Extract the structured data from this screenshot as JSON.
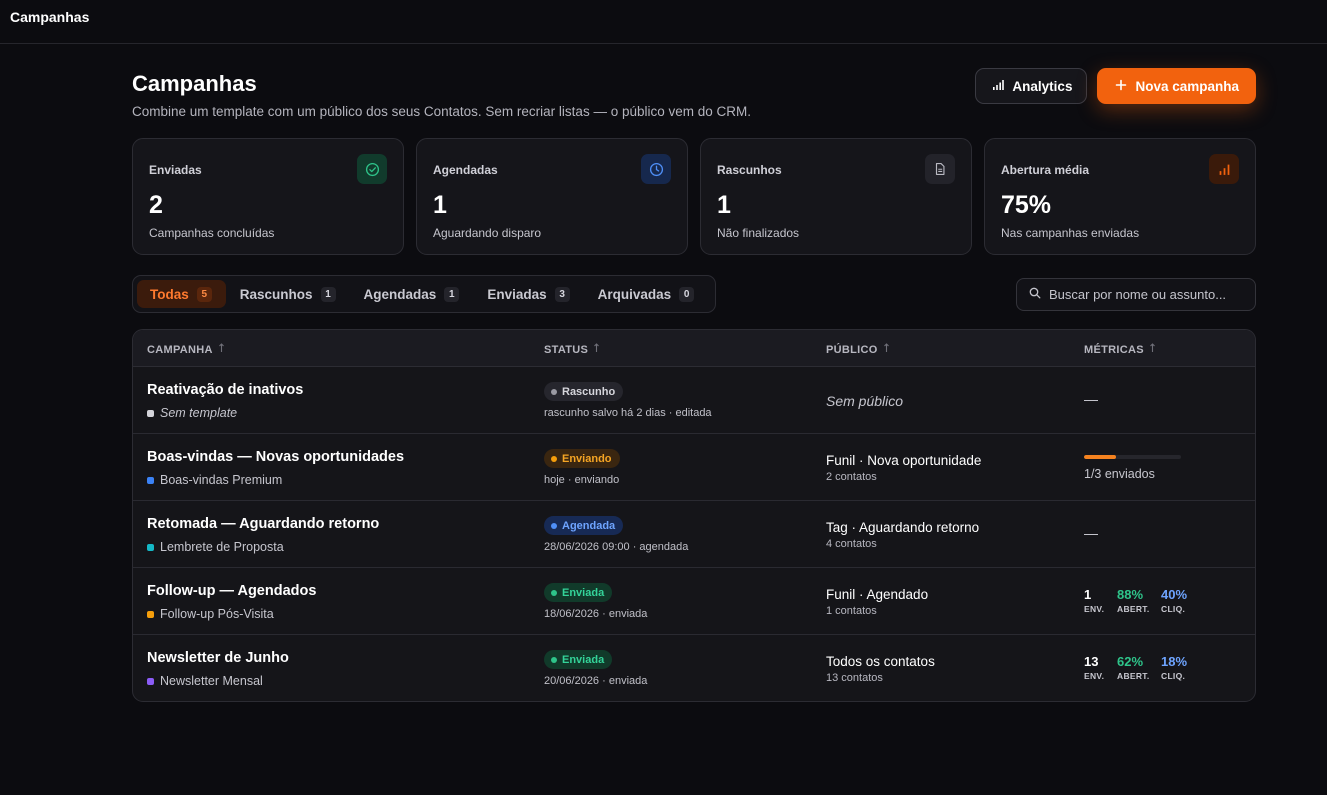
{
  "topbar": {
    "title": "Campanhas"
  },
  "header": {
    "title": "Campanhas",
    "subtitle": "Combine um template com um público dos seus Contatos. Sem recriar listas — o público vem do CRM.",
    "analytics_label": "Analytics",
    "new_campaign_label": "Nova campanha"
  },
  "stats": [
    {
      "label": "Enviadas",
      "value": "2",
      "sub": "Campanhas concluídas",
      "icon": "check-circle-icon",
      "color": "#2ec48a"
    },
    {
      "label": "Agendadas",
      "value": "1",
      "sub": "Aguardando disparo",
      "icon": "clock-icon",
      "color": "#4f8ff7"
    },
    {
      "label": "Rascunhos",
      "value": "1",
      "sub": "Não finalizados",
      "icon": "document-icon",
      "color": "#b9b9c2"
    },
    {
      "label": "Abertura média",
      "value": "75%",
      "sub": "Nas campanhas enviadas",
      "icon": "bar-chart-icon",
      "color": "#f2620e"
    }
  ],
  "tabs": [
    {
      "label": "Todas",
      "count": "5",
      "active": true
    },
    {
      "label": "Rascunhos",
      "count": "1"
    },
    {
      "label": "Agendadas",
      "count": "1"
    },
    {
      "label": "Enviadas",
      "count": "3"
    },
    {
      "label": "Arquivadas",
      "count": "0"
    }
  ],
  "search": {
    "placeholder": "Buscar por nome ou assunto..."
  },
  "table": {
    "columns": [
      "CAMPANHA",
      "STATUS",
      "PÚBLICO",
      "MÉTRICAS"
    ],
    "rows": [
      {
        "name": "Reativação de inativos",
        "template": "Sem template",
        "template_color": "#d4d4da",
        "status": "Rascunho",
        "status_sub": "rascunho salvo há 2 dias · edita­da",
        "audience": "Sem público",
        "metrics_empty": "—"
      },
      {
        "name": "Boas-vindas — Novas oportunidades",
        "template": "Boas-vindas Premium",
        "template_color": "#3b82f6",
        "status": "Enviando",
        "status_sub": "hoje · enviando",
        "audience": "Funil · Nova oportunidade",
        "audience_sub": "2 contatos",
        "progress": 0.3333,
        "progress_label": "1/3 enviados"
      },
      {
        "name": "Retomada — Aguardando retorno",
        "template": "Lembrete de Proposta",
        "template_color": "#14b8c6",
        "status": "Agendada",
        "status_sub": "28/06/2026 09:00 · agendada",
        "audience": "Tag · Aguardando retorno",
        "audience_sub": "4 contatos",
        "metrics_empty": "—"
      },
      {
        "name": "Follow-up — Agendados",
        "template": "Follow-up Pós-Visita",
        "template_color": "#f59e0b",
        "status": "Enviada",
        "status_sub": "18/06/2026 · enviada",
        "audience": "Funil · Agendado",
        "audience_sub": "1 contatos",
        "metrics": {
          "sent": "1",
          "open": "88%",
          "click": "40%"
        }
      },
      {
        "name": "Newsletter de Junho",
        "template": "Newsletter Mensal",
        "template_color": "#8b5cf6",
        "status": "Enviada",
        "status_sub": "20/06/2026 · enviada",
        "audience": "Todos os contatos",
        "audience_sub": "13 contatos",
        "metrics": {
          "sent": "13",
          "open": "62%",
          "click": "18%"
        }
      }
    ],
    "metric_labels": {
      "sent": "ENV.",
      "open": "ABERT.",
      "click": "CLIQ."
    }
  },
  "colors": {
    "accent": "#f2620e",
    "draft": "#9a9aa3",
    "sending": "#f59e0b",
    "scheduled": "#4f8ff7",
    "sent": "#2ec48a",
    "open": "#2ec48a",
    "click": "#6ea4ff"
  }
}
